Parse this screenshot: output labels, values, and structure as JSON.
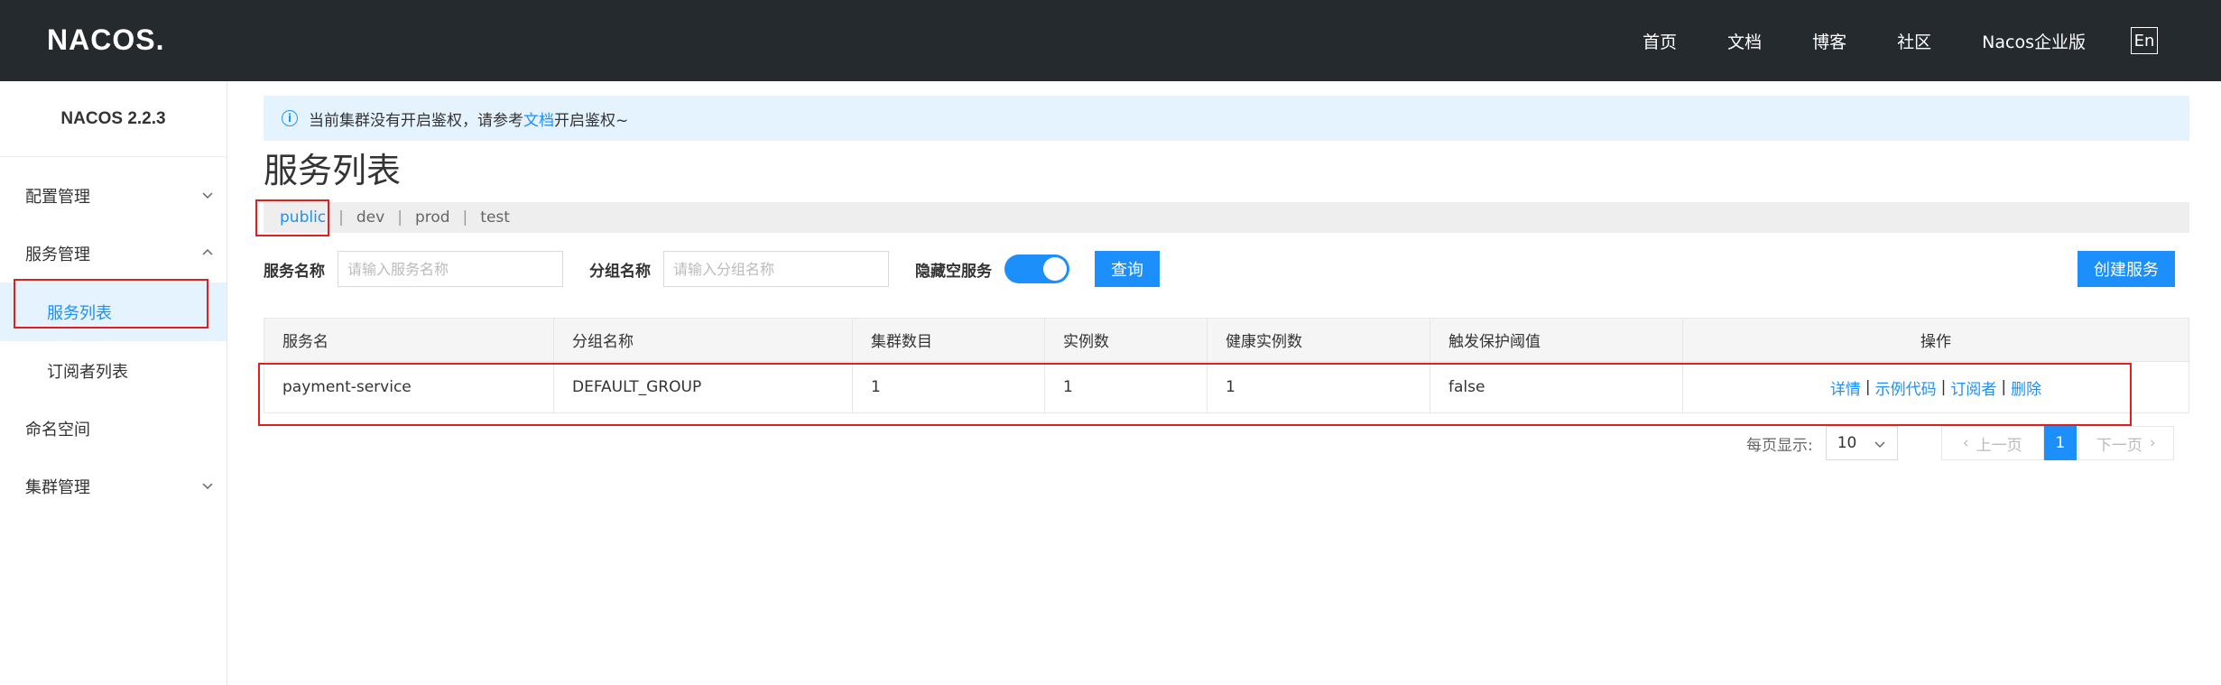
{
  "header": {
    "logo": "NACOS.",
    "nav": [
      "首页",
      "文档",
      "博客",
      "社区",
      "Nacos企业版"
    ],
    "lang": "En"
  },
  "sidebar": {
    "version": "NACOS 2.2.3",
    "items": [
      {
        "label": "配置管理",
        "expandable": true
      },
      {
        "label": "服务管理",
        "expandable": true
      },
      {
        "label": "服务列表",
        "active": true
      },
      {
        "label": "订阅者列表"
      },
      {
        "label": "命名空间"
      },
      {
        "label": "集群管理",
        "expandable": true
      }
    ]
  },
  "notice": {
    "prefix": "当前集群没有开启鉴权，请参考",
    "link": "文档",
    "suffix": "开启鉴权~"
  },
  "page": {
    "title": "服务列表"
  },
  "namespaces": [
    "public",
    "dev",
    "prod",
    "test"
  ],
  "active_namespace": "public",
  "filters": {
    "service_name_label": "服务名称",
    "service_name_placeholder": "请输入服务名称",
    "group_name_label": "分组名称",
    "group_name_placeholder": "请输入分组名称",
    "hide_empty_label": "隐藏空服务",
    "hide_empty_on": true,
    "query_button": "查询",
    "create_button": "创建服务"
  },
  "table": {
    "columns": [
      "服务名",
      "分组名称",
      "集群数目",
      "实例数",
      "健康实例数",
      "触发保护阈值",
      "操作"
    ],
    "rows": [
      {
        "service": "payment-service",
        "group": "DEFAULT_GROUP",
        "clusters": "1",
        "instances": "1",
        "healthy": "1",
        "threshold": "false"
      }
    ],
    "actions": [
      "详情",
      "示例代码",
      "订阅者",
      "删除"
    ]
  },
  "pagination": {
    "page_size_label": "每页显示:",
    "page_size": "10",
    "prev": "上一页",
    "current": "1",
    "next": "下一页"
  },
  "colors": {
    "accent": "#1d8ffa",
    "header_bg": "#252a2f",
    "highlight": "#e02020"
  }
}
